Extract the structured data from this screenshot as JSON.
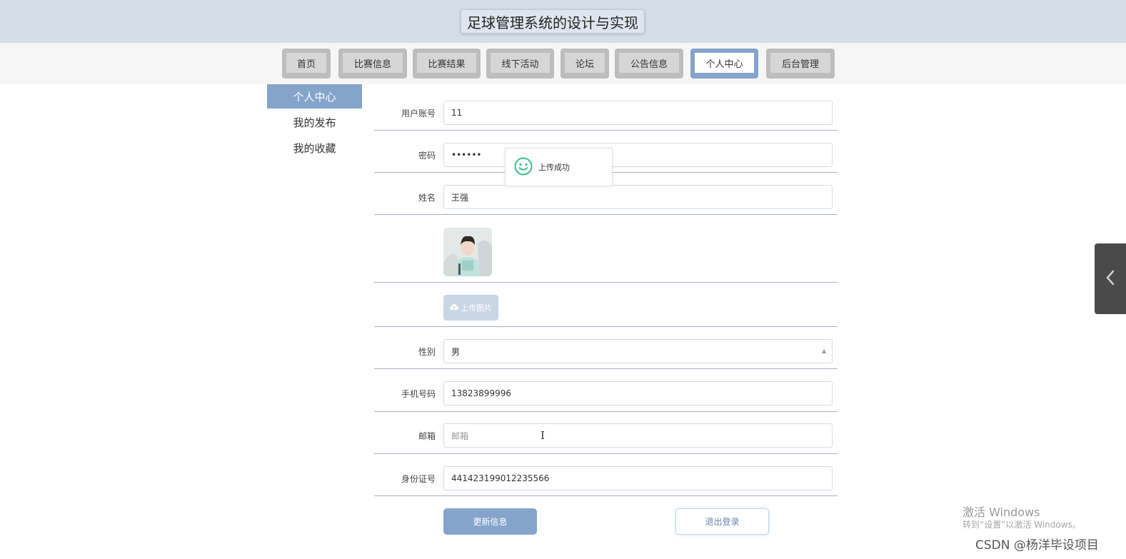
{
  "site": {
    "title": "足球管理系统的设计与实现"
  },
  "nav": {
    "tabs": [
      {
        "label": "首页",
        "active": false
      },
      {
        "label": "比赛信息",
        "active": false
      },
      {
        "label": "比赛结果",
        "active": false
      },
      {
        "label": "线下活动",
        "active": false
      },
      {
        "label": "论坛",
        "active": false
      },
      {
        "label": "公告信息",
        "active": false
      },
      {
        "label": "个人中心",
        "active": true
      },
      {
        "label": "后台管理",
        "active": false
      }
    ]
  },
  "sidebar": {
    "items": [
      {
        "label": "个人中心",
        "active": true
      },
      {
        "label": "我的发布",
        "active": false
      },
      {
        "label": "我的收藏",
        "active": false
      }
    ]
  },
  "form": {
    "account": {
      "label": "用户账号",
      "value": "11"
    },
    "password": {
      "label": "密码",
      "value": "••••••"
    },
    "name": {
      "label": "姓名",
      "value": "王强"
    },
    "upload_label": "上传图片",
    "gender": {
      "label": "性别",
      "value": "男"
    },
    "phone": {
      "label": "手机号码",
      "value": "13823899996"
    },
    "email": {
      "label": "邮箱",
      "placeholder": "邮箱"
    },
    "id_number": {
      "label": "身份证号",
      "value": "441423199012235566"
    }
  },
  "toast": {
    "message": "上传成功"
  },
  "buttons": {
    "update": "更新信息",
    "logout": "退出登录"
  },
  "watermark": {
    "activate_title": "激活 Windows",
    "activate_sub": "转到“设置”以激活 Windows。",
    "csdn": "CSDN @杨洋毕设项目"
  },
  "colors": {
    "accent": "#85a4cc",
    "header_bg": "#d5dde8",
    "success": "#3dbd8a"
  }
}
